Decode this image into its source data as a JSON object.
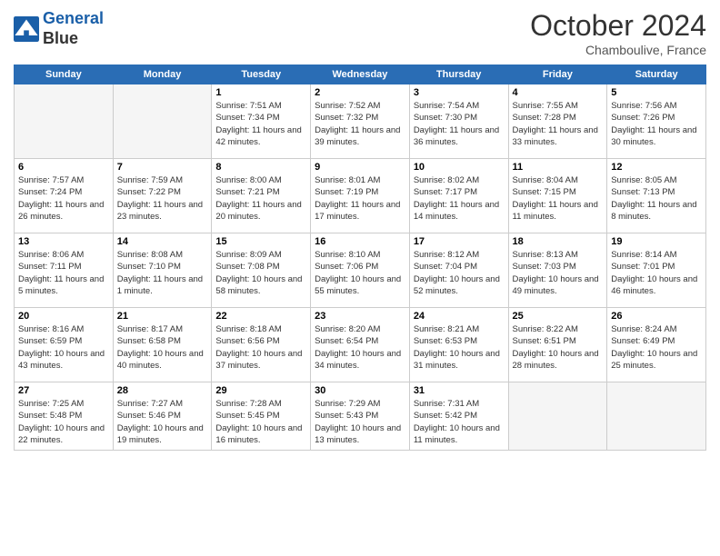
{
  "header": {
    "logo_line1": "General",
    "logo_line2": "Blue",
    "month": "October 2024",
    "location": "Chamboulive, France"
  },
  "days_of_week": [
    "Sunday",
    "Monday",
    "Tuesday",
    "Wednesday",
    "Thursday",
    "Friday",
    "Saturday"
  ],
  "weeks": [
    [
      {
        "day": "",
        "info": ""
      },
      {
        "day": "",
        "info": ""
      },
      {
        "day": "1",
        "sunrise": "7:51 AM",
        "sunset": "7:34 PM",
        "daylight": "11 hours and 42 minutes."
      },
      {
        "day": "2",
        "sunrise": "7:52 AM",
        "sunset": "7:32 PM",
        "daylight": "11 hours and 39 minutes."
      },
      {
        "day": "3",
        "sunrise": "7:54 AM",
        "sunset": "7:30 PM",
        "daylight": "11 hours and 36 minutes."
      },
      {
        "day": "4",
        "sunrise": "7:55 AM",
        "sunset": "7:28 PM",
        "daylight": "11 hours and 33 minutes."
      },
      {
        "day": "5",
        "sunrise": "7:56 AM",
        "sunset": "7:26 PM",
        "daylight": "11 hours and 30 minutes."
      }
    ],
    [
      {
        "day": "6",
        "sunrise": "7:57 AM",
        "sunset": "7:24 PM",
        "daylight": "11 hours and 26 minutes."
      },
      {
        "day": "7",
        "sunrise": "7:59 AM",
        "sunset": "7:22 PM",
        "daylight": "11 hours and 23 minutes."
      },
      {
        "day": "8",
        "sunrise": "8:00 AM",
        "sunset": "7:21 PM",
        "daylight": "11 hours and 20 minutes."
      },
      {
        "day": "9",
        "sunrise": "8:01 AM",
        "sunset": "7:19 PM",
        "daylight": "11 hours and 17 minutes."
      },
      {
        "day": "10",
        "sunrise": "8:02 AM",
        "sunset": "7:17 PM",
        "daylight": "11 hours and 14 minutes."
      },
      {
        "day": "11",
        "sunrise": "8:04 AM",
        "sunset": "7:15 PM",
        "daylight": "11 hours and 11 minutes."
      },
      {
        "day": "12",
        "sunrise": "8:05 AM",
        "sunset": "7:13 PM",
        "daylight": "11 hours and 8 minutes."
      }
    ],
    [
      {
        "day": "13",
        "sunrise": "8:06 AM",
        "sunset": "7:11 PM",
        "daylight": "11 hours and 5 minutes."
      },
      {
        "day": "14",
        "sunrise": "8:08 AM",
        "sunset": "7:10 PM",
        "daylight": "11 hours and 1 minute."
      },
      {
        "day": "15",
        "sunrise": "8:09 AM",
        "sunset": "7:08 PM",
        "daylight": "10 hours and 58 minutes."
      },
      {
        "day": "16",
        "sunrise": "8:10 AM",
        "sunset": "7:06 PM",
        "daylight": "10 hours and 55 minutes."
      },
      {
        "day": "17",
        "sunrise": "8:12 AM",
        "sunset": "7:04 PM",
        "daylight": "10 hours and 52 minutes."
      },
      {
        "day": "18",
        "sunrise": "8:13 AM",
        "sunset": "7:03 PM",
        "daylight": "10 hours and 49 minutes."
      },
      {
        "day": "19",
        "sunrise": "8:14 AM",
        "sunset": "7:01 PM",
        "daylight": "10 hours and 46 minutes."
      }
    ],
    [
      {
        "day": "20",
        "sunrise": "8:16 AM",
        "sunset": "6:59 PM",
        "daylight": "10 hours and 43 minutes."
      },
      {
        "day": "21",
        "sunrise": "8:17 AM",
        "sunset": "6:58 PM",
        "daylight": "10 hours and 40 minutes."
      },
      {
        "day": "22",
        "sunrise": "8:18 AM",
        "sunset": "6:56 PM",
        "daylight": "10 hours and 37 minutes."
      },
      {
        "day": "23",
        "sunrise": "8:20 AM",
        "sunset": "6:54 PM",
        "daylight": "10 hours and 34 minutes."
      },
      {
        "day": "24",
        "sunrise": "8:21 AM",
        "sunset": "6:53 PM",
        "daylight": "10 hours and 31 minutes."
      },
      {
        "day": "25",
        "sunrise": "8:22 AM",
        "sunset": "6:51 PM",
        "daylight": "10 hours and 28 minutes."
      },
      {
        "day": "26",
        "sunrise": "8:24 AM",
        "sunset": "6:49 PM",
        "daylight": "10 hours and 25 minutes."
      }
    ],
    [
      {
        "day": "27",
        "sunrise": "7:25 AM",
        "sunset": "5:48 PM",
        "daylight": "10 hours and 22 minutes."
      },
      {
        "day": "28",
        "sunrise": "7:27 AM",
        "sunset": "5:46 PM",
        "daylight": "10 hours and 19 minutes."
      },
      {
        "day": "29",
        "sunrise": "7:28 AM",
        "sunset": "5:45 PM",
        "daylight": "10 hours and 16 minutes."
      },
      {
        "day": "30",
        "sunrise": "7:29 AM",
        "sunset": "5:43 PM",
        "daylight": "10 hours and 13 minutes."
      },
      {
        "day": "31",
        "sunrise": "7:31 AM",
        "sunset": "5:42 PM",
        "daylight": "10 hours and 11 minutes."
      },
      {
        "day": "",
        "info": ""
      },
      {
        "day": "",
        "info": ""
      }
    ]
  ]
}
